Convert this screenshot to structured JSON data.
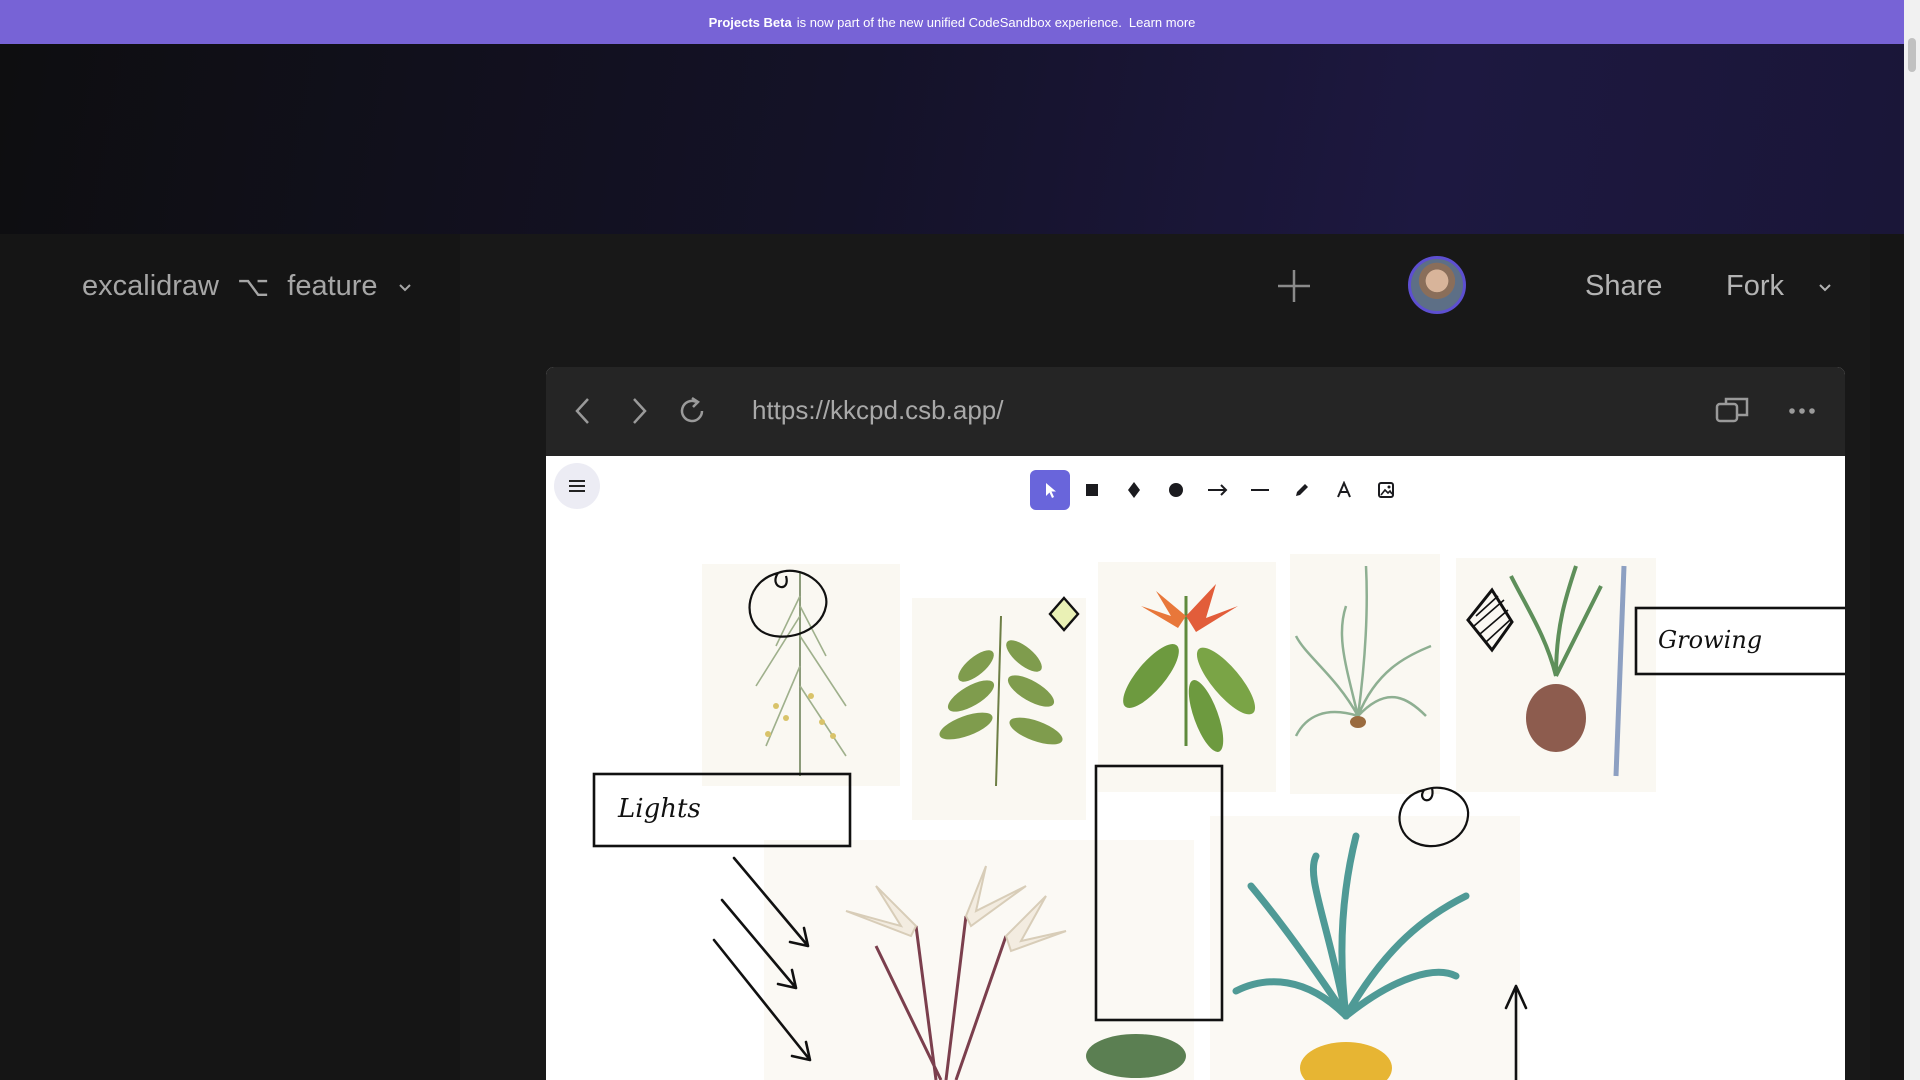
{
  "banner": {
    "bold": "Projects Beta",
    "text": "is now part of the new unified CodeSandbox experience.",
    "link": "Learn more"
  },
  "header": {
    "project": "excalidraw",
    "branch": "feature",
    "share_label": "Share",
    "fork_label": "Fork"
  },
  "browser": {
    "url": "https://kkcpd.csb.app/"
  },
  "canvas": {
    "tools": [
      "selection-tool",
      "rectangle-tool",
      "diamond-tool",
      "ellipse-tool",
      "arrow-tool",
      "line-tool",
      "pencil-tool",
      "text-tool",
      "image-tool"
    ],
    "active_tool": "selection-tool",
    "labels": {
      "lights": "Lights",
      "growing": "Growing"
    }
  },
  "colors": {
    "banner": "#7763d6",
    "accent": "#6965db",
    "avatar_ring": "#5d4fd1"
  }
}
